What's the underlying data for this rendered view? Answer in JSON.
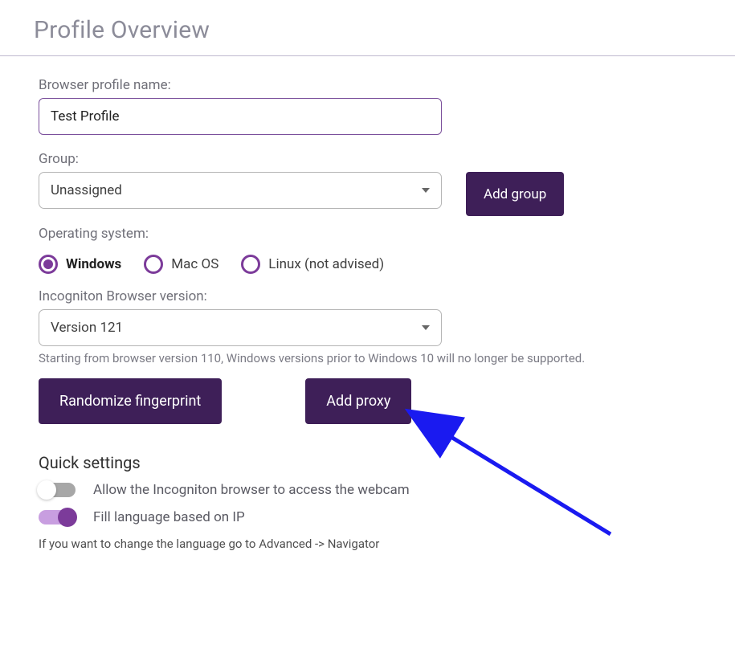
{
  "page_title": "Profile Overview",
  "profile_name": {
    "label": "Browser profile name:",
    "value": "Test Profile"
  },
  "group": {
    "label": "Group:",
    "selected": "Unassigned",
    "add_button": "Add group"
  },
  "os": {
    "label": "Operating system:",
    "options": [
      "Windows",
      "Mac OS",
      "Linux (not advised)"
    ],
    "selected": "Windows"
  },
  "browser_version": {
    "label": "Incogniton Browser version:",
    "selected": "Version 121",
    "hint": "Starting from browser version 110, Windows versions prior to Windows 10 will no longer be supported."
  },
  "actions": {
    "randomize": "Randomize fingerprint",
    "add_proxy": "Add proxy"
  },
  "quick_settings": {
    "heading": "Quick settings",
    "webcam": {
      "label": "Allow the Incogniton browser to access the webcam",
      "enabled": false
    },
    "fill_lang": {
      "label": "Fill language based on IP",
      "enabled": true
    },
    "note": "If you want to change the language go to Advanced -> Navigator"
  },
  "colors": {
    "brand_dark": "#3e1f58",
    "brand_purple": "#7c3b9a"
  }
}
